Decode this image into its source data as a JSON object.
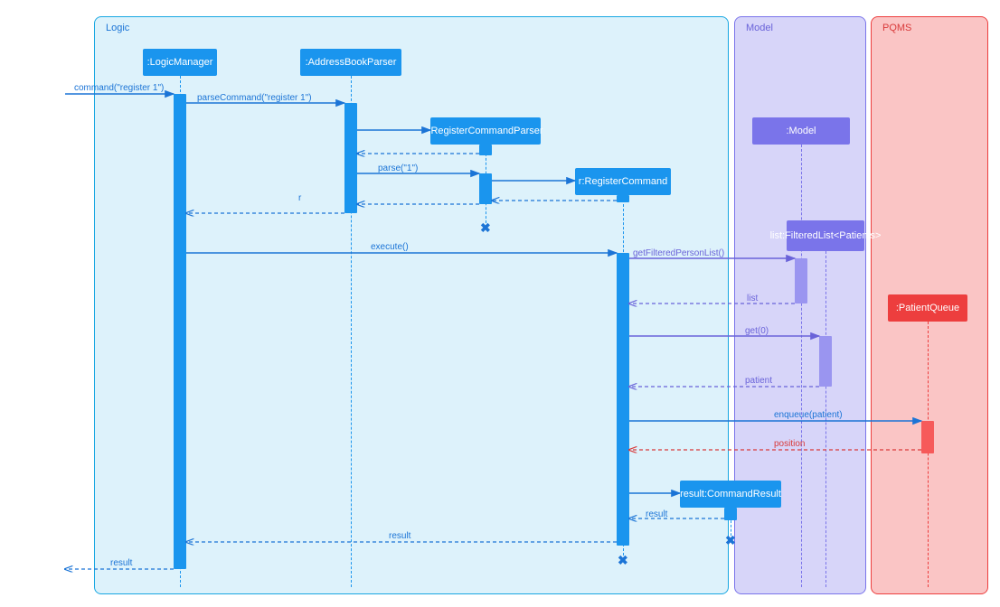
{
  "frames": {
    "logic": "Logic",
    "model": "Model",
    "pqms": "PQMS"
  },
  "lifelines": {
    "logicManager": ":LogicManager",
    "addressBookParser": ":AddressBookParser",
    "registerCommandParser": ":RegisterCommandParser",
    "registerCommand": "r:RegisterCommand",
    "model": ":Model",
    "filteredList": "list:FilteredList<Patients>",
    "patientQueue": ":PatientQueue",
    "commandResult": "result:CommandResult"
  },
  "messages": {
    "command": "command(\"register 1\")",
    "parseCommand": "parseCommand(\"register 1\")",
    "parse": "parse(\"1\")",
    "r": "r",
    "execute": "execute()",
    "getFiltered": "getFilteredPersonList()",
    "list": "list",
    "get0": "get(0)",
    "patient": "patient",
    "enqueue": "enqueue(patient)",
    "position": "position",
    "resultReturn": "result",
    "resultFinal": "result"
  },
  "chart_data": {
    "type": "sequence-diagram",
    "frames": [
      {
        "name": "Logic",
        "children": [
          "LogicManager",
          "AddressBookParser",
          "RegisterCommandParser",
          "r:RegisterCommand",
          "result:CommandResult"
        ]
      },
      {
        "name": "Model",
        "children": [
          "Model",
          "list:FilteredList<Patients>"
        ]
      },
      {
        "name": "PQMS",
        "children": [
          "PatientQueue"
        ]
      }
    ],
    "lifelines": [
      ":LogicManager",
      ":AddressBookParser",
      ":RegisterCommandParser",
      "r:RegisterCommand",
      ":Model",
      "list:FilteredList<Patients>",
      ":PatientQueue",
      "result:CommandResult"
    ],
    "messages": [
      {
        "from": "external",
        "to": ":LogicManager",
        "label": "command(\"register 1\")",
        "type": "sync"
      },
      {
        "from": ":LogicManager",
        "to": ":AddressBookParser",
        "label": "parseCommand(\"register 1\")",
        "type": "sync"
      },
      {
        "from": ":AddressBookParser",
        "to": ":RegisterCommandParser",
        "label": "",
        "type": "create"
      },
      {
        "from": ":RegisterCommandParser",
        "to": ":AddressBookParser",
        "label": "",
        "type": "return"
      },
      {
        "from": ":AddressBookParser",
        "to": ":RegisterCommandParser",
        "label": "parse(\"1\")",
        "type": "sync"
      },
      {
        "from": ":RegisterCommandParser",
        "to": "r:RegisterCommand",
        "label": "",
        "type": "create"
      },
      {
        "from": "r:RegisterCommand",
        "to": ":RegisterCommandParser",
        "label": "",
        "type": "return"
      },
      {
        "from": ":RegisterCommandParser",
        "to": ":AddressBookParser",
        "label": "r",
        "type": "return"
      },
      {
        "from": ":AddressBookParser",
        "to": ":LogicManager",
        "label": "",
        "type": "return"
      },
      {
        "from": ":RegisterCommandParser",
        "to": null,
        "label": "",
        "type": "destroy"
      },
      {
        "from": ":LogicManager",
        "to": "r:RegisterCommand",
        "label": "execute()",
        "type": "sync"
      },
      {
        "from": "r:RegisterCommand",
        "to": ":Model",
        "label": "getFilteredPersonList()",
        "type": "sync"
      },
      {
        "from": ":Model",
        "to": "r:RegisterCommand",
        "label": "list",
        "type": "return"
      },
      {
        "from": "r:RegisterCommand",
        "to": "list:FilteredList<Patients>",
        "label": "get(0)",
        "type": "sync"
      },
      {
        "from": "list:FilteredList<Patients>",
        "to": "r:RegisterCommand",
        "label": "patient",
        "type": "return"
      },
      {
        "from": "r:RegisterCommand",
        "to": ":PatientQueue",
        "label": "enqueue(patient)",
        "type": "sync"
      },
      {
        "from": ":PatientQueue",
        "to": "r:RegisterCommand",
        "label": "position",
        "type": "return"
      },
      {
        "from": "r:RegisterCommand",
        "to": "result:CommandResult",
        "label": "",
        "type": "create"
      },
      {
        "from": "result:CommandResult",
        "to": "r:RegisterCommand",
        "label": "result",
        "type": "return"
      },
      {
        "from": "result:CommandResult",
        "to": null,
        "label": "",
        "type": "destroy"
      },
      {
        "from": "r:RegisterCommand",
        "to": ":LogicManager",
        "label": "result",
        "type": "return"
      },
      {
        "from": "r:RegisterCommand",
        "to": null,
        "label": "",
        "type": "destroy"
      },
      {
        "from": ":LogicManager",
        "to": "external",
        "label": "result",
        "type": "return"
      }
    ]
  }
}
